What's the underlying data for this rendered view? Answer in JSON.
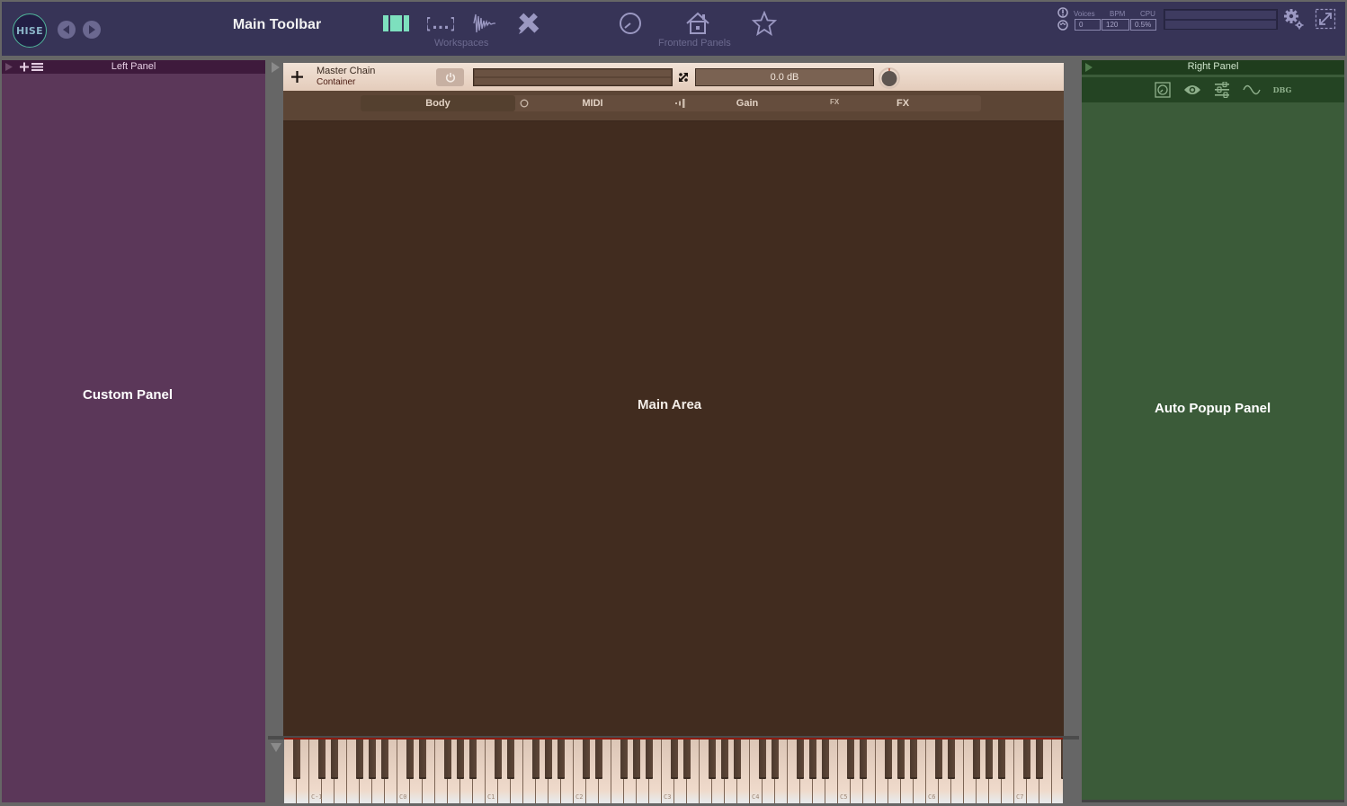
{
  "toolbar": {
    "logo_text": "HISE",
    "title": "Main Toolbar",
    "icons": [
      {
        "name": "main-editor-icon",
        "active": true
      },
      {
        "name": "code-editor-icon",
        "active": false
      },
      {
        "name": "sample-editor-icon",
        "active": false
      },
      {
        "name": "ui-designer-icon",
        "active": false
      }
    ],
    "workspaces_caption": "Workspaces",
    "frontend_icons": [
      "knob-icon",
      "home-icon",
      "star-icon"
    ],
    "frontend_caption": "Frontend Panels",
    "stats": {
      "voices_label": "Voices",
      "voices_value": "0",
      "bpm_label": "BPM",
      "bpm_value": "120",
      "cpu_label": "CPU",
      "cpu_value": "0.5%"
    },
    "accent_color": "#7de0be",
    "background_color": "#373457"
  },
  "left_panel": {
    "title": "Left Panel",
    "content_label": "Custom Panel",
    "color": "#5b3759"
  },
  "main": {
    "module_name": "Master Chain",
    "module_type": "Container",
    "gain_value": "0.0 dB",
    "tabs": [
      {
        "label": "Body",
        "active": true
      },
      {
        "label": "MIDI",
        "active": false
      },
      {
        "label": "Gain",
        "active": false
      },
      {
        "label": "FX",
        "active": false
      }
    ],
    "tab_icon_labels": {
      "fx": "FX"
    },
    "content_label": "Main Area",
    "color": "#412c1f"
  },
  "keyboard": {
    "octave_labels": [
      "C-1",
      "C0",
      "C1",
      "C2",
      "C3",
      "C4",
      "C5",
      "C6",
      "C7"
    ],
    "first_note": "A-2",
    "last_note": "F7"
  },
  "right_panel": {
    "title": "Right Panel",
    "tool_icons": [
      "plugin-preview-icon",
      "eye-icon",
      "sliders-icon",
      "waveform-icon"
    ],
    "debug_label": "DBG",
    "content_label": "Auto Popup Panel",
    "color": "#3b5b39"
  }
}
